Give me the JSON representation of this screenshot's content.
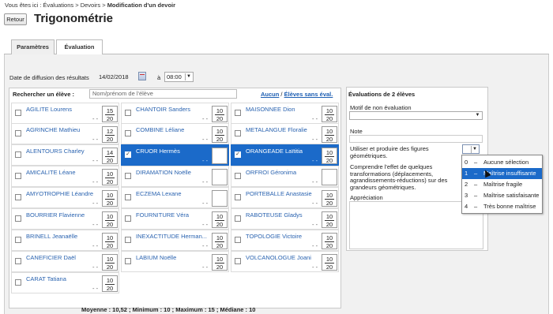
{
  "breadcrumb": {
    "prefix": "Vous êtes ici :",
    "items": "Évaluations > Devoirs >",
    "current": "Modification d'un devoir"
  },
  "retour_label": "Retour",
  "title": "Trigonométrie",
  "tabs": [
    {
      "label": "Paramètres"
    },
    {
      "label": "Évaluation"
    }
  ],
  "date": {
    "label": "Date de diffusion des résultats",
    "value": "14/02/2018",
    "at": "à",
    "time": "08:00"
  },
  "search": {
    "label": "Rechercher un élève :",
    "placeholder": "Nom/prénom de l'élève"
  },
  "links": {
    "aucun": "Aucun",
    "sep": " / ",
    "sans_eval": "Élèves sans éval."
  },
  "students": [
    {
      "name": "AGILITE Lourens",
      "grade": "15",
      "max": "20",
      "selected": false
    },
    {
      "name": "AGRINCHE Mathieu",
      "grade": "12",
      "max": "20",
      "selected": false
    },
    {
      "name": "ALENTOURS Charley",
      "grade": "14",
      "max": "20",
      "selected": false
    },
    {
      "name": "AMICALITE Léane",
      "grade": "10",
      "max": "20",
      "selected": false
    },
    {
      "name": "AMYOTROPHIE Léandre",
      "grade": "10",
      "max": "20",
      "selected": false
    },
    {
      "name": "BOURRIER Flavienne",
      "grade": "10",
      "max": "20",
      "selected": false
    },
    {
      "name": "BRINELL Jeanaëlle",
      "grade": "10",
      "max": "20",
      "selected": false
    },
    {
      "name": "CANEFICIER Daël",
      "grade": "10",
      "max": "20",
      "selected": false
    },
    {
      "name": "CARAT Tatiana",
      "grade": "10",
      "max": "20",
      "selected": false
    },
    {
      "name": "CHANTOIR Sanders",
      "grade": "10",
      "max": "20",
      "selected": false
    },
    {
      "name": "COMBINE Léliane",
      "grade": "10",
      "max": "20",
      "selected": false
    },
    {
      "name": "CRUOR Hermès",
      "grade": "",
      "max": "",
      "selected": true
    },
    {
      "name": "DIRAMATION Noëlle",
      "grade": "",
      "max": "",
      "selected": false
    },
    {
      "name": "ECZEMA Lexane",
      "grade": "",
      "max": "",
      "selected": false
    },
    {
      "name": "FOURNITURE Véra",
      "grade": "10",
      "max": "20",
      "selected": false
    },
    {
      "name": "INEXACTITUDE Herman...",
      "grade": "10",
      "max": "20",
      "selected": false
    },
    {
      "name": "LABIUM Noëlle",
      "grade": "10",
      "max": "20",
      "selected": false
    },
    {
      "name": "MAISONNEE Dion",
      "grade": "10",
      "max": "20",
      "selected": false
    },
    {
      "name": "METALANGUE Floralie",
      "grade": "10",
      "max": "20",
      "selected": false
    },
    {
      "name": "ORANGEADE Laïtitia",
      "grade": "10",
      "max": "20",
      "selected": true
    },
    {
      "name": "ORFROI Géronima",
      "grade": "",
      "max": "",
      "selected": false
    },
    {
      "name": "PORTEBALLE Anastasie",
      "grade": "10",
      "max": "20",
      "selected": false
    },
    {
      "name": "RABOTEUSE Gladys",
      "grade": "10",
      "max": "20",
      "selected": false
    },
    {
      "name": "TOPOLOGIE Victoire",
      "grade": "10",
      "max": "20",
      "selected": false
    },
    {
      "name": "VOLCANOLOGUE Joani",
      "grade": "10",
      "max": "20",
      "selected": false
    }
  ],
  "dash": "- -",
  "stats": "Moyenne : 10,52 ; Minimum : 10 ; Maximum : 15 ; Médiane : 10",
  "right": {
    "header": "Évaluations de 2 élèves",
    "motif_label": "Motif de non évaluation",
    "note_label": "Note",
    "competence1": "Utiliser et produire des figures géométriques.",
    "competence2": "Comprendre l'effet de quelques transformations (déplacements, agrandissements-réductions) sur des grandeurs géométriques.",
    "appreciation_label": "Appréciation"
  },
  "dropdown": [
    {
      "code": "0",
      "sep": "–",
      "label": "Aucune sélection"
    },
    {
      "code": "1",
      "sep": "–",
      "label": "Maîtrise insuffisante"
    },
    {
      "code": "2",
      "sep": "–",
      "label": "Maîtrise fragile"
    },
    {
      "code": "3",
      "sep": "–",
      "label": "Maîtrise satisfaisante"
    },
    {
      "code": "4",
      "sep": "–",
      "label": "Très bonne maîtrise"
    }
  ],
  "colors": {
    "accent": "#1b6ac9",
    "link": "#1e5fb3",
    "panel_bg": "#f1f1f1"
  }
}
